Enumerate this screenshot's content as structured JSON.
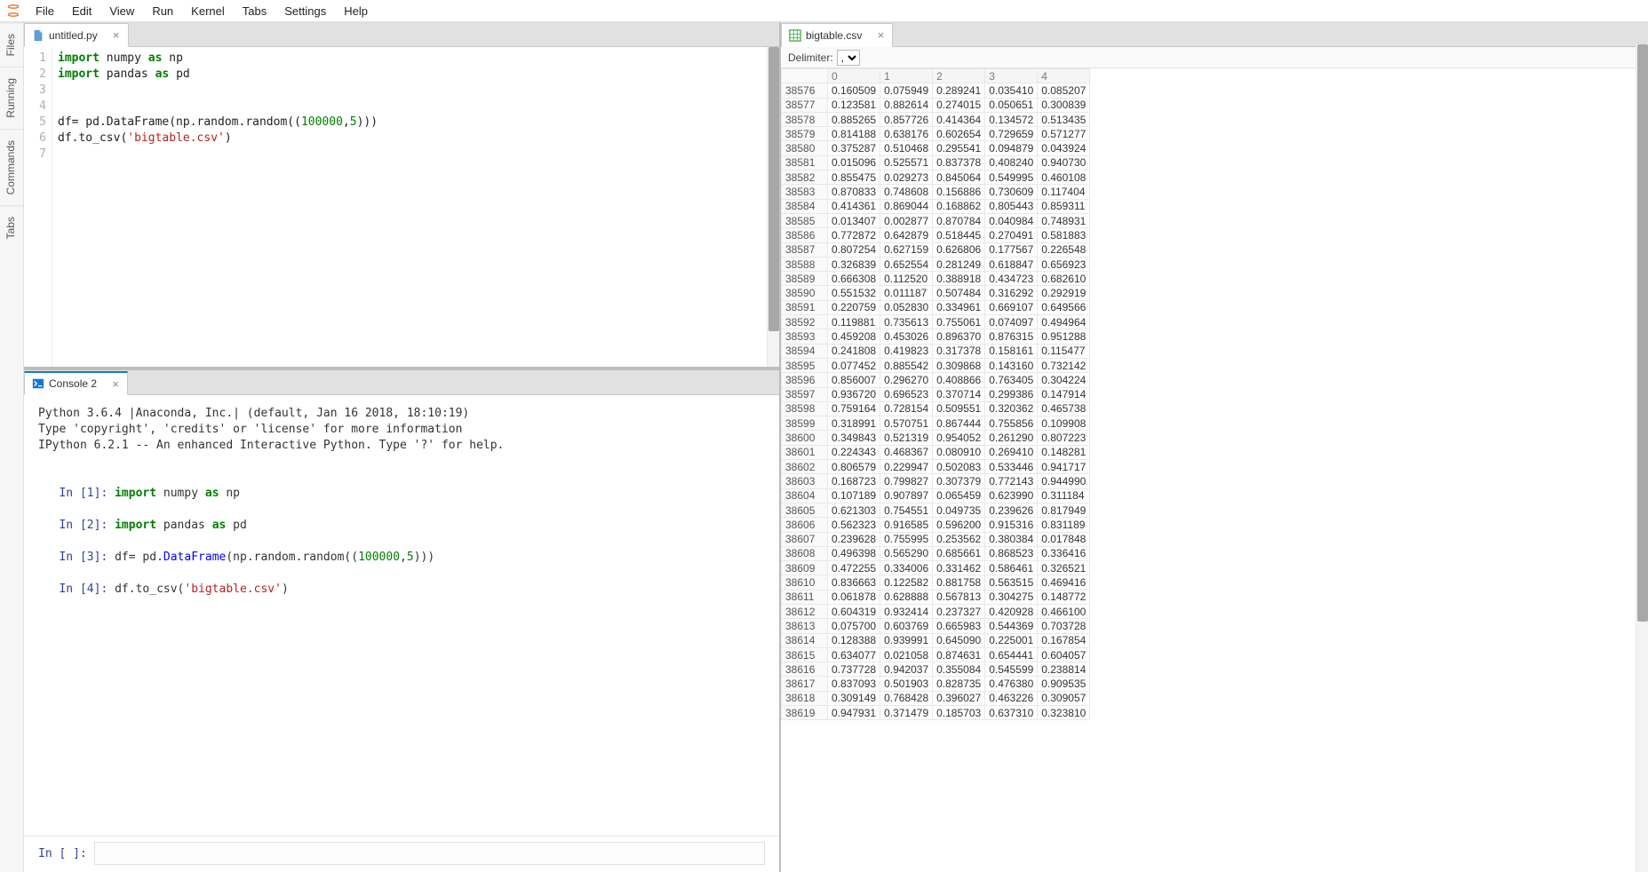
{
  "menu": [
    "File",
    "Edit",
    "View",
    "Run",
    "Kernel",
    "Tabs",
    "Settings",
    "Help"
  ],
  "side_tabs": [
    "Files",
    "Running",
    "Commands",
    "Tabs"
  ],
  "editor_tab": {
    "label": "untitled.py"
  },
  "editor_lines": 7,
  "console_tab": {
    "label": "Console 2"
  },
  "console_banner": [
    "Python 3.6.4 |Anaconda, Inc.| (default, Jan 16 2018, 18:10:19)",
    "Type 'copyright', 'credits' or 'license' for more information",
    "IPython 6.2.1 -- An enhanced Interactive Python. Type '?' for help."
  ],
  "console_prompt_empty": "In [ ]:",
  "csv_tab": {
    "label": "bigtable.csv"
  },
  "delimiter_label": "Delimiter:",
  "delimiter_value": ",",
  "csv_columns": [
    "0",
    "1",
    "2",
    "3",
    "4"
  ],
  "csv_rows": [
    {
      "idx": "38576",
      "v": [
        "0.160509",
        "0.075949",
        "0.289241",
        "0.035410",
        "0.085207"
      ]
    },
    {
      "idx": "38577",
      "v": [
        "0.123581",
        "0.882614",
        "0.274015",
        "0.050651",
        "0.300839"
      ]
    },
    {
      "idx": "38578",
      "v": [
        "0.885265",
        "0.857726",
        "0.414364",
        "0.134572",
        "0.513435"
      ]
    },
    {
      "idx": "38579",
      "v": [
        "0.814188",
        "0.638176",
        "0.602654",
        "0.729659",
        "0.571277"
      ]
    },
    {
      "idx": "38580",
      "v": [
        "0.375287",
        "0.510468",
        "0.295541",
        "0.094879",
        "0.043924"
      ]
    },
    {
      "idx": "38581",
      "v": [
        "0.015096",
        "0.525571",
        "0.837378",
        "0.408240",
        "0.940730"
      ]
    },
    {
      "idx": "38582",
      "v": [
        "0.855475",
        "0.029273",
        "0.845064",
        "0.549995",
        "0.460108"
      ]
    },
    {
      "idx": "38583",
      "v": [
        "0.870833",
        "0.748608",
        "0.156886",
        "0.730609",
        "0.117404"
      ]
    },
    {
      "idx": "38584",
      "v": [
        "0.414361",
        "0.869044",
        "0.168862",
        "0.805443",
        "0.859311"
      ]
    },
    {
      "idx": "38585",
      "v": [
        "0.013407",
        "0.002877",
        "0.870784",
        "0.040984",
        "0.748931"
      ]
    },
    {
      "idx": "38586",
      "v": [
        "0.772872",
        "0.642879",
        "0.518445",
        "0.270491",
        "0.581883"
      ]
    },
    {
      "idx": "38587",
      "v": [
        "0.807254",
        "0.627159",
        "0.626806",
        "0.177567",
        "0.226548"
      ]
    },
    {
      "idx": "38588",
      "v": [
        "0.326839",
        "0.652554",
        "0.281249",
        "0.618847",
        "0.656923"
      ]
    },
    {
      "idx": "38589",
      "v": [
        "0.666308",
        "0.112520",
        "0.388918",
        "0.434723",
        "0.682610"
      ]
    },
    {
      "idx": "38590",
      "v": [
        "0.551532",
        "0.011187",
        "0.507484",
        "0.316292",
        "0.292919"
      ]
    },
    {
      "idx": "38591",
      "v": [
        "0.220759",
        "0.052830",
        "0.334961",
        "0.669107",
        "0.649566"
      ]
    },
    {
      "idx": "38592",
      "v": [
        "0.119881",
        "0.735613",
        "0.755061",
        "0.074097",
        "0.494964"
      ]
    },
    {
      "idx": "38593",
      "v": [
        "0.459208",
        "0.453026",
        "0.896370",
        "0.876315",
        "0.951288"
      ]
    },
    {
      "idx": "38594",
      "v": [
        "0.241808",
        "0.419823",
        "0.317378",
        "0.158161",
        "0.115477"
      ]
    },
    {
      "idx": "38595",
      "v": [
        "0.077452",
        "0.885542",
        "0.309868",
        "0.143160",
        "0.732142"
      ]
    },
    {
      "idx": "38596",
      "v": [
        "0.856007",
        "0.296270",
        "0.408866",
        "0.763405",
        "0.304224"
      ]
    },
    {
      "idx": "38597",
      "v": [
        "0.936720",
        "0.696523",
        "0.370714",
        "0.299386",
        "0.147914"
      ]
    },
    {
      "idx": "38598",
      "v": [
        "0.759164",
        "0.728154",
        "0.509551",
        "0.320362",
        "0.465738"
      ]
    },
    {
      "idx": "38599",
      "v": [
        "0.318991",
        "0.570751",
        "0.867444",
        "0.755856",
        "0.109908"
      ]
    },
    {
      "idx": "38600",
      "v": [
        "0.349843",
        "0.521319",
        "0.954052",
        "0.261290",
        "0.807223"
      ]
    },
    {
      "idx": "38601",
      "v": [
        "0.224343",
        "0.468367",
        "0.080910",
        "0.269410",
        "0.148281"
      ]
    },
    {
      "idx": "38602",
      "v": [
        "0.806579",
        "0.229947",
        "0.502083",
        "0.533446",
        "0.941717"
      ]
    },
    {
      "idx": "38603",
      "v": [
        "0.168723",
        "0.799827",
        "0.307379",
        "0.772143",
        "0.944990"
      ]
    },
    {
      "idx": "38604",
      "v": [
        "0.107189",
        "0.907897",
        "0.065459",
        "0.623990",
        "0.311184"
      ]
    },
    {
      "idx": "38605",
      "v": [
        "0.621303",
        "0.754551",
        "0.049735",
        "0.239626",
        "0.817949"
      ]
    },
    {
      "idx": "38606",
      "v": [
        "0.562323",
        "0.916585",
        "0.596200",
        "0.915316",
        "0.831189"
      ]
    },
    {
      "idx": "38607",
      "v": [
        "0.239628",
        "0.755995",
        "0.253562",
        "0.380384",
        "0.017848"
      ]
    },
    {
      "idx": "38608",
      "v": [
        "0.496398",
        "0.565290",
        "0.685661",
        "0.868523",
        "0.336416"
      ]
    },
    {
      "idx": "38609",
      "v": [
        "0.472255",
        "0.334006",
        "0.331462",
        "0.586461",
        "0.326521"
      ]
    },
    {
      "idx": "38610",
      "v": [
        "0.836663",
        "0.122582",
        "0.881758",
        "0.563515",
        "0.469416"
      ]
    },
    {
      "idx": "38611",
      "v": [
        "0.061878",
        "0.628888",
        "0.567813",
        "0.304275",
        "0.148772"
      ]
    },
    {
      "idx": "38612",
      "v": [
        "0.604319",
        "0.932414",
        "0.237327",
        "0.420928",
        "0.466100"
      ]
    },
    {
      "idx": "38613",
      "v": [
        "0.075700",
        "0.603769",
        "0.665983",
        "0.544369",
        "0.703728"
      ]
    },
    {
      "idx": "38614",
      "v": [
        "0.128388",
        "0.939991",
        "0.645090",
        "0.225001",
        "0.167854"
      ]
    },
    {
      "idx": "38615",
      "v": [
        "0.634077",
        "0.021058",
        "0.874631",
        "0.654441",
        "0.604057"
      ]
    },
    {
      "idx": "38616",
      "v": [
        "0.737728",
        "0.942037",
        "0.355084",
        "0.545599",
        "0.238814"
      ]
    },
    {
      "idx": "38617",
      "v": [
        "0.837093",
        "0.501903",
        "0.828735",
        "0.476380",
        "0.909535"
      ]
    },
    {
      "idx": "38618",
      "v": [
        "0.309149",
        "0.768428",
        "0.396027",
        "0.463226",
        "0.309057"
      ]
    },
    {
      "idx": "38619",
      "v": [
        "0.947931",
        "0.371479",
        "0.185703",
        "0.637310",
        "0.323810"
      ]
    }
  ]
}
